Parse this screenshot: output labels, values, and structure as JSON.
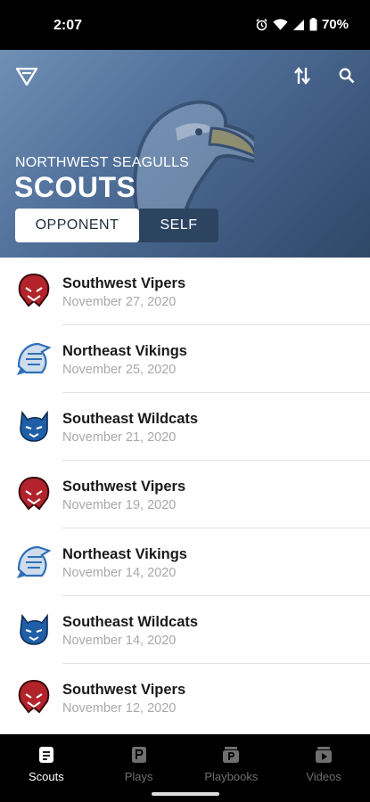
{
  "status_bar": {
    "time": "2:07",
    "battery": "70%",
    "icons": [
      "alarm-icon",
      "wifi-icon",
      "signal-icon",
      "battery-icon"
    ]
  },
  "header": {
    "team_name": "NORTHWEST SEAGULLS",
    "title": "SCOUTS",
    "segments": [
      {
        "label": "OPPONENT",
        "selected": true
      },
      {
        "label": "SELF",
        "selected": false
      }
    ],
    "icons": [
      "app-logo-icon",
      "sort-icon",
      "search-icon",
      "seagull-mascot"
    ]
  },
  "scouts": [
    {
      "team": "Southwest Vipers",
      "date": "November 27, 2020",
      "logo": "viper-logo"
    },
    {
      "team": "Northeast Vikings",
      "date": "November 25, 2020",
      "logo": "viking-logo"
    },
    {
      "team": "Southeast Wildcats",
      "date": "November 21, 2020",
      "logo": "wildcat-logo"
    },
    {
      "team": "Southwest Vipers",
      "date": "November 19, 2020",
      "logo": "viper-logo"
    },
    {
      "team": "Northeast Vikings",
      "date": "November 14, 2020",
      "logo": "viking-logo"
    },
    {
      "team": "Southeast Wildcats",
      "date": "November 14, 2020",
      "logo": "wildcat-logo"
    },
    {
      "team": "Southwest Vipers",
      "date": "November 12, 2020",
      "logo": "viper-logo"
    }
  ],
  "bottom_nav": [
    {
      "label": "Scouts",
      "icon": "scouts-icon",
      "active": true
    },
    {
      "label": "Plays",
      "icon": "plays-icon",
      "active": false
    },
    {
      "label": "Playbooks",
      "icon": "playbooks-icon",
      "active": false
    },
    {
      "label": "Videos",
      "icon": "videos-icon",
      "active": false
    }
  ],
  "colors": {
    "header_start": "#6f8fb5",
    "header_end": "#2f4868",
    "segment_inactive": "#2d4461",
    "viper_red": "#b3232b",
    "viking_blue": "#2f6fb8",
    "wildcat_blue": "#1f5fa8",
    "date_gray": "#a8a8a8"
  }
}
